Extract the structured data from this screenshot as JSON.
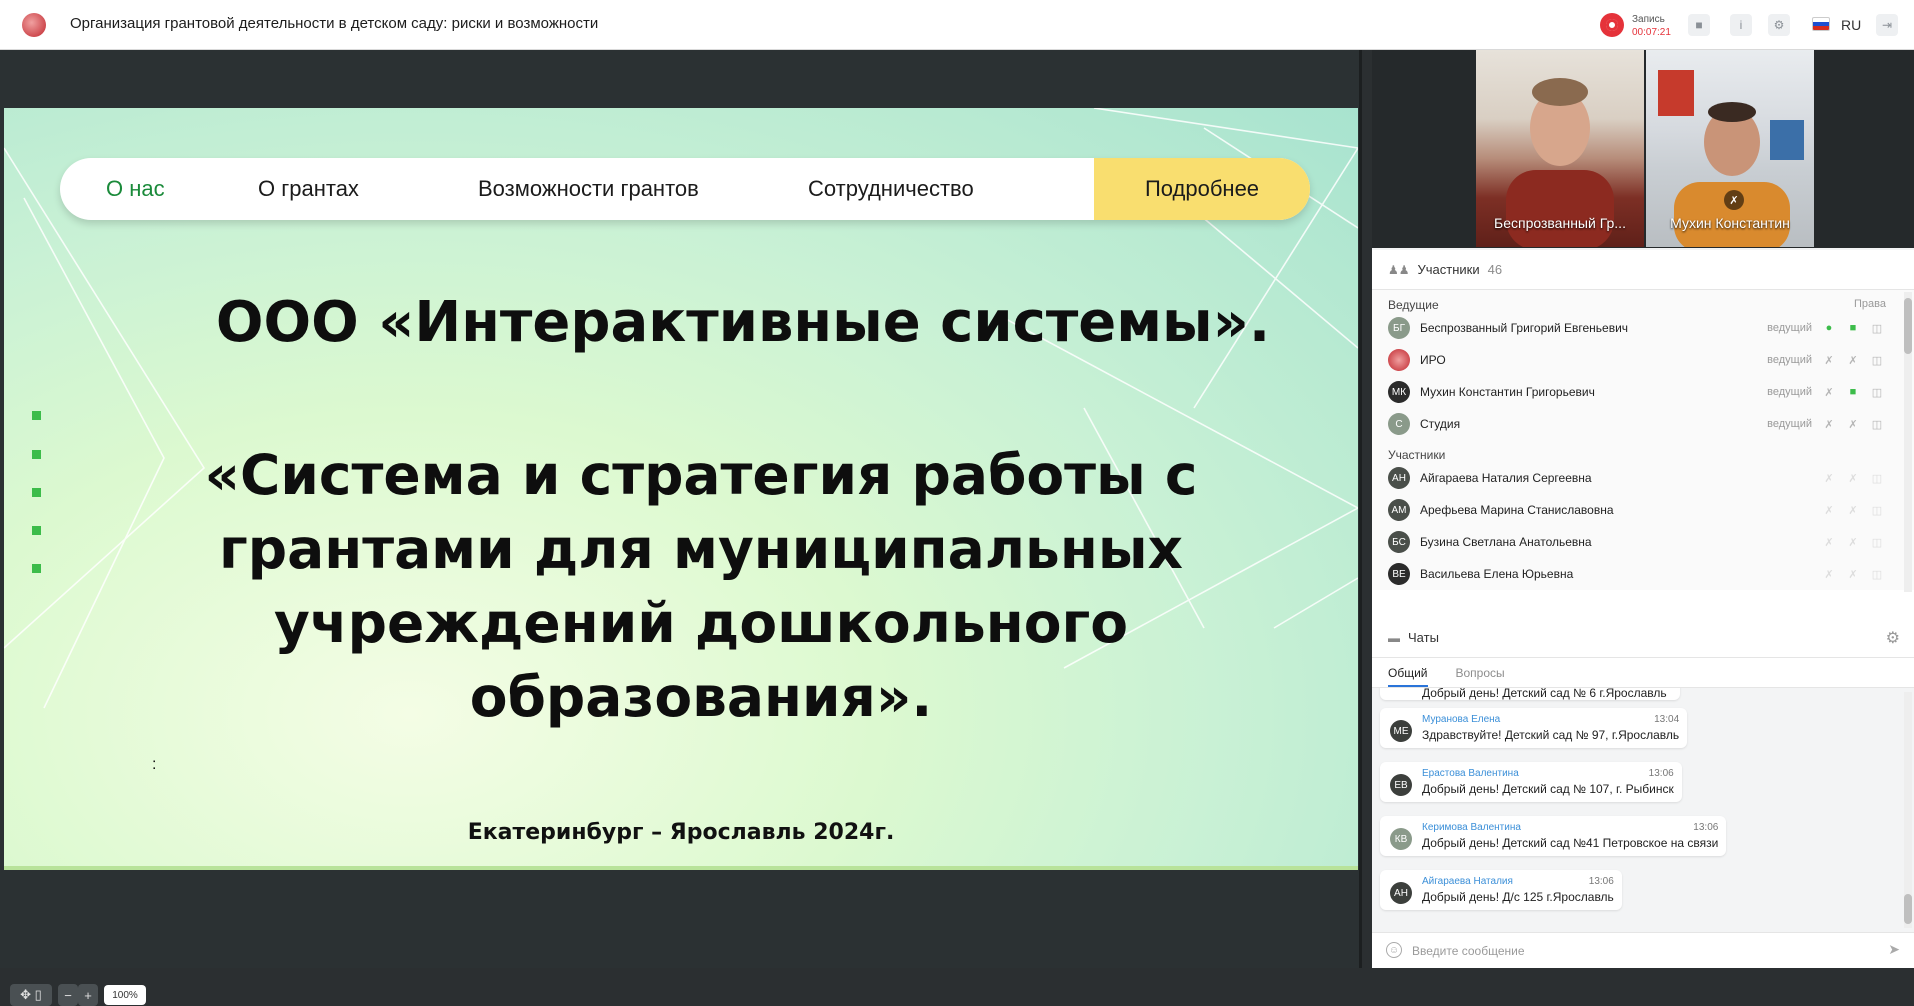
{
  "header": {
    "title": "Организация грантовой деятельности в детском саду: риски и возможности",
    "record_label": "Запись",
    "record_time": "00:07:21",
    "language": "RU"
  },
  "slide": {
    "nav": {
      "items": [
        "О нас",
        "О грантах",
        "Возможности грантов",
        "Сотрудничество"
      ],
      "cta": "Подробнее"
    },
    "heading": "ООО «Интерактивные системы».",
    "subheading_lines": [
      "«Система и стратегия работы с",
      "грантами для муниципальных",
      "учреждений дошкольного",
      "образования»."
    ],
    "colon": ":",
    "footer": "Екатеринбург – Ярославль 2024г."
  },
  "zoom": {
    "value": "100%"
  },
  "videos": [
    {
      "name": "Беспрозванный Гр..."
    },
    {
      "name": "Мухин Константин"
    }
  ],
  "participants": {
    "title": "Участники",
    "count": "46",
    "hosts_label": "Ведущие",
    "rights_label": "Права",
    "members_label": "Участники",
    "hosts": [
      {
        "initials": "БГ",
        "name": "Беспрозванный Григорий Евгеньевич",
        "role": "ведущий",
        "color": "#8a9a8a"
      },
      {
        "initials": "",
        "name": "ИРО",
        "role": "ведущий",
        "color": "#c0262d"
      },
      {
        "initials": "МК",
        "name": "Мухин Константин Григорьевич",
        "role": "ведущий",
        "color": "#2b2b2b"
      },
      {
        "initials": "С",
        "name": "Студия",
        "role": "ведущий",
        "color": "#8a9a8a"
      }
    ],
    "members": [
      {
        "initials": "АН",
        "name": "Айгараева Наталия Сергеевна",
        "color": "#4a4f4a"
      },
      {
        "initials": "АМ",
        "name": "Арефьева Марина Станиславовна",
        "color": "#4a4f4a"
      },
      {
        "initials": "БС",
        "name": "Бузина Светлана Анатольевна",
        "color": "#4a4f4a"
      },
      {
        "initials": "ВЕ",
        "name": "Васильева Елена Юрьевна",
        "color": "#2b2b2b"
      }
    ]
  },
  "chat": {
    "title": "Чаты",
    "tabs": [
      "Общий",
      "Вопросы"
    ],
    "partial_message": "Добрый день! Детский сад № 6 г.Ярославль",
    "messages": [
      {
        "initials": "МЕ",
        "author": "Муранова Елена",
        "time": "13:04",
        "text": "Здравствуйте! Детский сад № 97, г.Ярославль",
        "color": "#3c3f3c"
      },
      {
        "initials": "ЕВ",
        "author": "Ерастова Валентина",
        "time": "13:06",
        "text": "Добрый день! Детский сад № 107, г. Рыбинск",
        "color": "#3c3f3c"
      },
      {
        "initials": "КВ",
        "author": "Керимова Валентина",
        "time": "13:06",
        "text": "Добрый день! Детский сад №41 Петровское на связи",
        "color": "#8a9a8a"
      },
      {
        "initials": "АН",
        "author": "Айгараева Наталия",
        "time": "13:06",
        "text": "Добрый день! Д/с 125 г.Ярославль",
        "color": "#3c3f3c"
      }
    ],
    "input_placeholder": "Введите сообщение"
  }
}
